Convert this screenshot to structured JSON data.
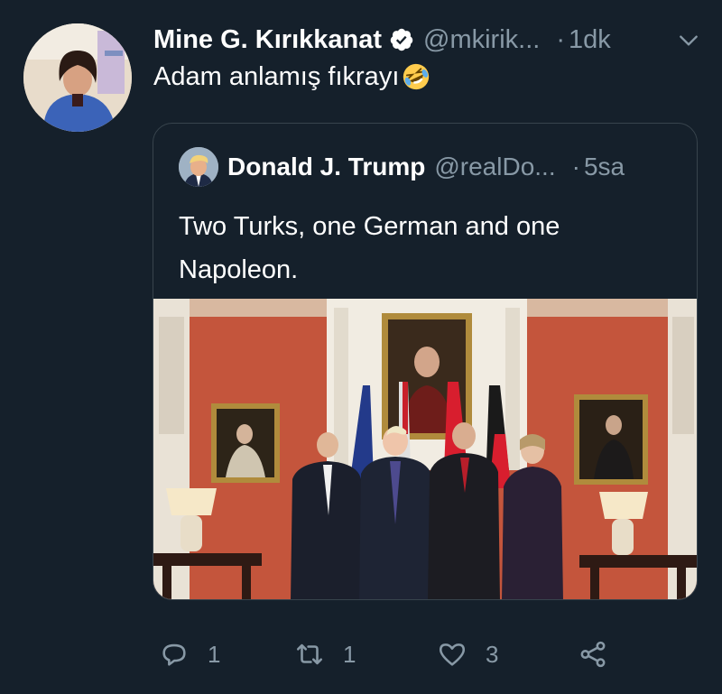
{
  "tweet": {
    "author_name": "Mine G. Kırıkkanat",
    "handle": "@mkirik...",
    "separator": "·",
    "time": "1dk",
    "text": "Adam anlamış fıkrayı",
    "verified_icon": "verified-badge-icon",
    "emoji_icon": "rofl-emoji-icon"
  },
  "quoted": {
    "author_name": "Donald J. Trump",
    "handle": "@realDo...",
    "separator": "·",
    "time": "5sa",
    "text": "Two Turks, one German and one Napoleon."
  },
  "actions": {
    "reply_count": "1",
    "retweet_count": "1",
    "like_count": "3"
  },
  "colors": {
    "background": "#15202b",
    "muted": "#8899a6",
    "border": "#38444d",
    "verified": "#ffffff"
  }
}
